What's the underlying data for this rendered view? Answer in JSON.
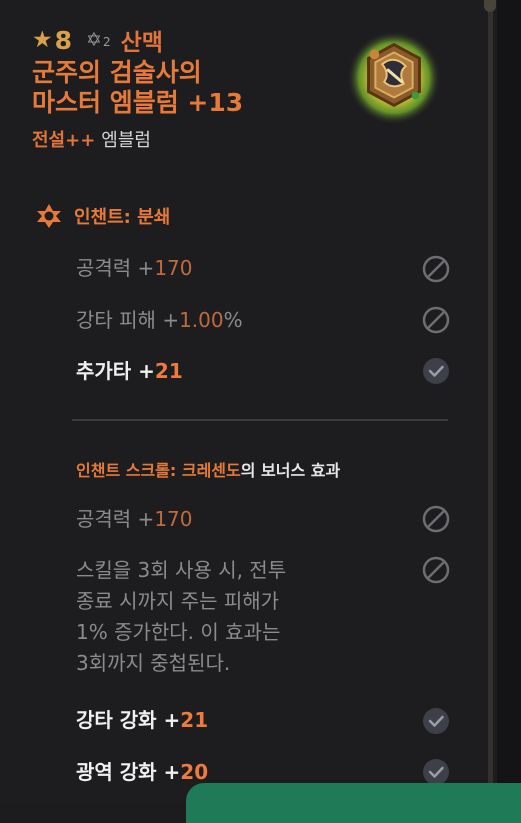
{
  "item": {
    "star_level": "8",
    "tier": "2",
    "category": "산맥",
    "name_line1": "군주의 검술사의",
    "name_line2": "마스터 엠블럼 +13",
    "grade_label": "전설++",
    "type_label": "엠블럼"
  },
  "enchant": {
    "title": "인챈트: 분쇄",
    "stats": [
      {
        "label": "공격력 +",
        "value": "170",
        "state": "disabled"
      },
      {
        "label": "강타 피해 +",
        "value": "1.00",
        "suffix": "%",
        "state": "disabled"
      },
      {
        "label": "추가타 +",
        "value": "21",
        "state": "active"
      }
    ]
  },
  "scroll": {
    "title_orange": "인챈트 스크롤: 크레센도",
    "title_white": "의 보너스 효과",
    "stat1": {
      "label": "공격력 +",
      "value": "170",
      "state": "disabled"
    },
    "description": [
      "스킬을 3회 사용 시, 전투",
      "종료 시까지 주는 피해가",
      "1% 증가한다. 이 효과는",
      "3회까지 중첩된다."
    ],
    "description_state": "disabled",
    "stat2": {
      "label": "강타 강화 +",
      "value": "21",
      "state": "active"
    },
    "stat3": {
      "label": "광역 강화 +",
      "value": "20",
      "state": "active"
    }
  },
  "colors": {
    "accent_orange": "#e77a38",
    "star_gold": "#d8a14a",
    "background": "#1d1d20",
    "green_tab": "#1f7a57"
  },
  "icons": [
    "star-icon",
    "tier-star-icon",
    "emblem-image",
    "enchant-star-icon",
    "disabled-icon",
    "check-icon"
  ]
}
